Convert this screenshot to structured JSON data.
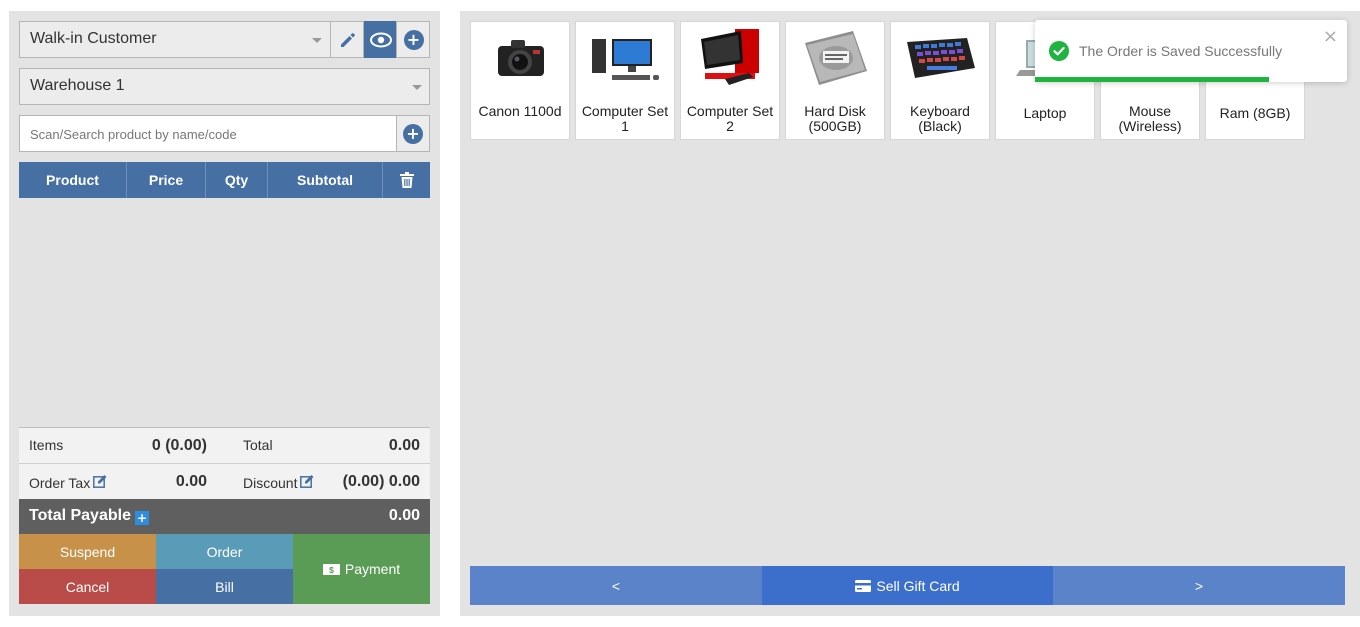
{
  "customer": {
    "selected": "Walk-in Customer"
  },
  "warehouse": {
    "selected": "Warehouse 1"
  },
  "search": {
    "placeholder": "Scan/Search product by name/code"
  },
  "cart_table": {
    "columns": [
      "Product",
      "Price",
      "Qty",
      "Subtotal"
    ],
    "rows": []
  },
  "totals": {
    "items_label": "Items",
    "items_value": "0 (0.00)",
    "total_label": "Total",
    "total_value": "0.00",
    "order_tax_label": "Order Tax",
    "order_tax_value": "0.00",
    "discount_label": "Discount",
    "discount_value": "(0.00) 0.00",
    "payable_label": "Total Payable",
    "payable_value": "0.00"
  },
  "actions": {
    "suspend": "Suspend",
    "order": "Order",
    "payment": "Payment",
    "cancel": "Cancel",
    "bill": "Bill"
  },
  "products": [
    {
      "name": "Canon 1100d",
      "icon": "camera-icon"
    },
    {
      "name": "Computer Set 1",
      "icon": "desktop-computer-icon"
    },
    {
      "name": "Computer Set 2",
      "icon": "desktop-computer-icon"
    },
    {
      "name": "Hard Disk (500GB)",
      "icon": "hard-disk-icon"
    },
    {
      "name": "Keyboard (Black)",
      "icon": "keyboard-icon"
    },
    {
      "name": "Laptop",
      "icon": "laptop-icon"
    },
    {
      "name": "Mouse (Wireless)",
      "icon": "mouse-icon"
    },
    {
      "name": "Ram (8GB)",
      "icon": "ram-icon"
    }
  ],
  "pager": {
    "prev": "<",
    "gift": "Sell Gift Card",
    "next": ">"
  },
  "toast": {
    "message": "The Order is Saved Successfully",
    "close": "×",
    "progress": 0.75
  },
  "colors": {
    "primary": "#4670a4",
    "suspend": "#c8914a",
    "order": "#5a9bb8",
    "payment": "#5a9b55",
    "cancel": "#b94b48",
    "pager": "#5b83c9",
    "gift": "#3c6fcb",
    "success": "#1fb33f"
  }
}
